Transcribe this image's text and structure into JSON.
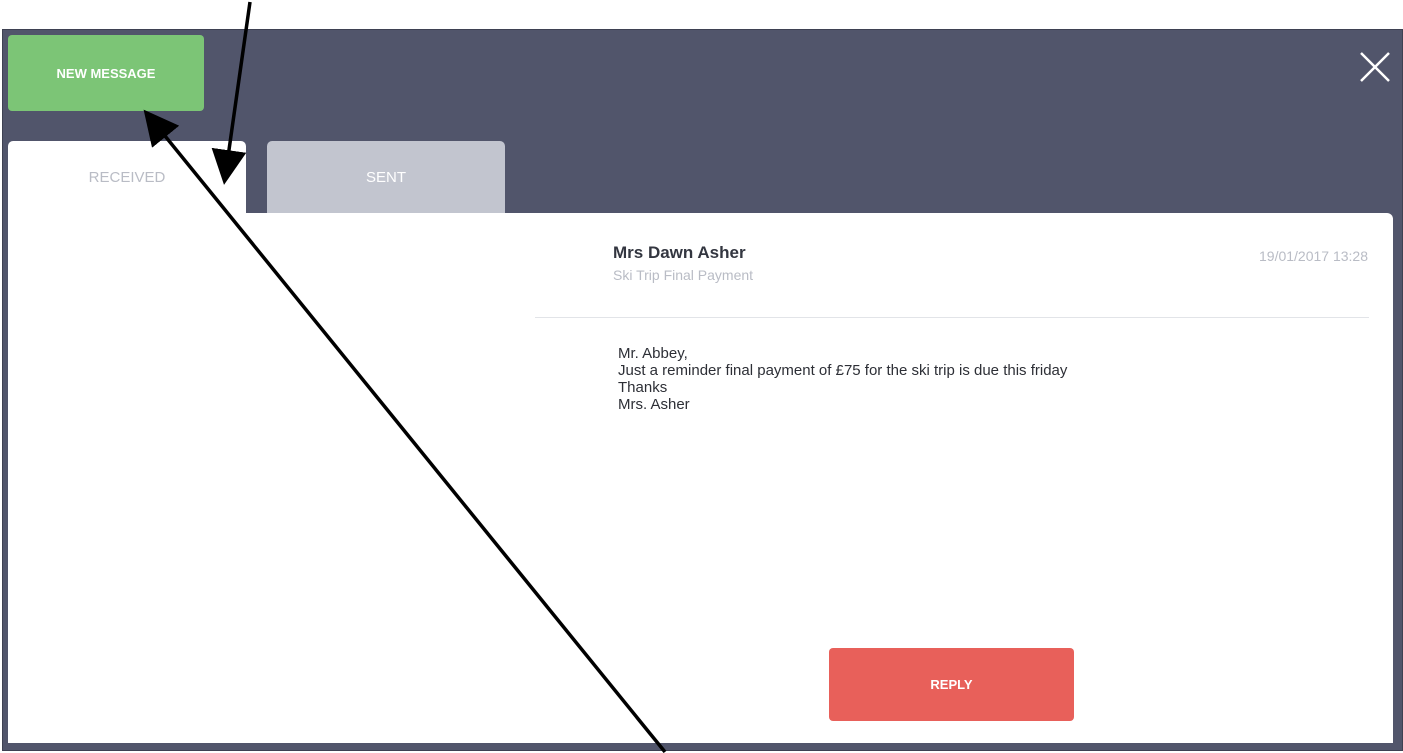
{
  "toolbar": {
    "new_message_label": "NEW MESSAGE",
    "close_icon": "close-icon"
  },
  "tabs": [
    {
      "label": "RECEIVED",
      "active": true
    },
    {
      "label": "SENT",
      "active": false
    }
  ],
  "message": {
    "sender": "Mrs Dawn Asher",
    "subject": "Ski Trip Final Payment",
    "timestamp": "19/01/2017 13:28",
    "body_lines": [
      "Mr. Abbey,",
      "Just a reminder final payment of £75 for the ski trip is due this friday",
      "Thanks",
      "Mrs. Asher"
    ]
  },
  "actions": {
    "reply_label": "REPLY"
  },
  "colors": {
    "header_bg": "#51556b",
    "new_message_green": "#7cc576",
    "reply_red": "#e8605a",
    "sent_tab_bg": "#c2c5cf"
  }
}
